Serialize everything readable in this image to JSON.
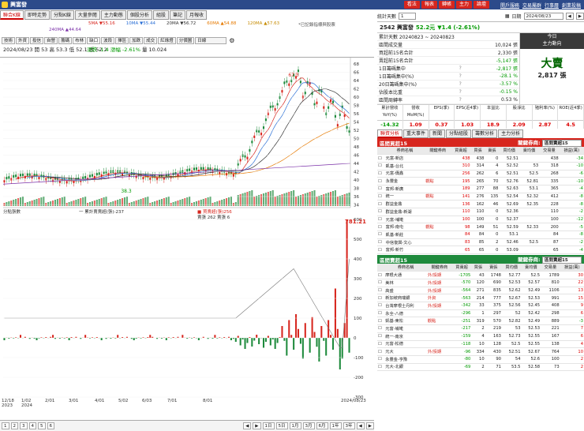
{
  "app": {
    "title": "興富發",
    "buttons": [
      "看法",
      "報表",
      "轉帳",
      "主力",
      "論壇"
    ],
    "links": [
      "開戶服務",
      "交易屬群",
      "行事曆",
      "創業投稿"
    ]
  },
  "tabs": [
    "聯合K線",
    "即時走勢",
    "分點K線",
    "大量參閱",
    "主力動態",
    "個股分析",
    "組股",
    "筆記",
    "月報收"
  ],
  "legend": {
    "sma5": "5MA ▼55.16",
    "sma10": "10MA ▼55.44",
    "sma20": "20MA ▼56.72",
    "sma60": "60MA ▲54.88",
    "sma120": "120MA ▲57.63",
    "sma240": "240MA ▲44.64",
    "note": "*已記錄指標與股票"
  },
  "toolbar": [
    "技術",
    "外資",
    "投信",
    "自營",
    "籌碼",
    "布林",
    "缺口",
    "波段",
    "擇區",
    "加跌",
    "成交",
    "紅綠燈",
    "分價圖",
    "日線"
  ],
  "info": {
    "date": "2024/08/23",
    "open": "開 53",
    "high": "高 53.3",
    "low": "低 52.1",
    "close": "收 52.2",
    "change": "漲跌 -1.4",
    "pct": "漲幅 -2.61%",
    "vol": "量 10.024"
  },
  "annot": {
    "peak": "67.3",
    "low": "38.3"
  },
  "yaxis": [
    "68",
    "66",
    "64",
    "62",
    "60",
    "58",
    "56",
    "54",
    "52",
    "50",
    "48",
    "46",
    "44",
    "42",
    "40",
    "38",
    "36",
    "34"
  ],
  "subpanel": {
    "legend_left": "分點張數",
    "legend_mid": "一 累計賣賣超(張)-237",
    "legend_right": "■ 買賣超(張)256",
    "legend_r2": "賣張 262 賣張 6",
    "value": "781.21"
  },
  "subyaxis": [
    "600",
    "500",
    "400",
    "300",
    "200",
    "100",
    "0",
    "-100",
    "-200",
    "-300",
    "-400"
  ],
  "xaxis": [
    "12/18\n2023",
    "1/02\n2024",
    "2/01",
    "3/01",
    "4/01",
    "5/02",
    "6/03",
    "7/01",
    "8/01",
    "2024/08/23"
  ],
  "bottom": {
    "pages": [
      "1",
      "2",
      "3",
      "4",
      "5",
      "6"
    ],
    "periods": [
      "1日",
      "5日",
      "1月",
      "3月",
      "6月",
      "1年",
      "3年"
    ]
  },
  "right": {
    "ctrl": {
      "label": "統計天數",
      "value": "1",
      "date_label": "日期",
      "date": "2024/08/23"
    },
    "stock": {
      "code": "2542 興富發",
      "price": "52.2元",
      "chg": "▼1.4 (-2.61%)",
      "range": "累計天數 20240823 ~ 20240823"
    },
    "stats": [
      [
        "區間成交量",
        "",
        "10,024 張"
      ],
      [
        "買超前15名合計",
        "",
        "2,330 張"
      ],
      [
        "賣超前15名合計",
        "",
        "-5,147 張"
      ],
      [
        "1日籌碼集中",
        "?",
        "-2,817 張"
      ],
      [
        "1日籌碼集中(%)",
        "?",
        "-28.1 %"
      ],
      [
        "20日籌碼集中(%)",
        "?",
        "-3.57 %"
      ],
      [
        "佔股本比重",
        "?",
        "-0.15 %"
      ],
      [
        "區間周轉率",
        "?",
        "0.53 %"
      ]
    ],
    "big": {
      "hdr1": "今日",
      "hdr2": "主力動向",
      "val": "大賣",
      "sub": "2,817 張"
    },
    "metric_hdr": [
      "累計營收YoY(%)",
      "營收MoM(%)",
      "EPS(季)",
      "EPS(近4季)",
      "本益比",
      "股淨比",
      "殖利率(%)",
      "ROE(近4季)"
    ],
    "metric_val": [
      "-14.32",
      "1.09",
      "0.37",
      "1.03",
      "18.9",
      "2.09",
      "2.87",
      "4.5"
    ],
    "subtabs": [
      "聯資分析",
      "重大事件",
      "新聞",
      "分點組股",
      "籌數分析",
      "主力分析"
    ],
    "buy_title": "區間買超15",
    "sell_title": "區間賣超15",
    "filter": {
      "label": "關鍵券商:",
      "value": "區間賣超15"
    },
    "cols": [
      "",
      "券商名稱",
      "關鍵券商",
      "買賣超",
      "買張",
      "賣張",
      "買均價",
      "賣均價",
      "交易量",
      "損益(萬)"
    ],
    "buys": [
      [
        "",
        "元富-新店",
        "",
        "438",
        "438",
        "0",
        "52.51",
        "",
        "438",
        "-34"
      ],
      [
        "",
        "凱基-台北",
        "",
        "310",
        "314",
        "4",
        "52.52",
        "53",
        "318",
        "-10"
      ],
      [
        "",
        "元富-僑鑫",
        "",
        "256",
        "262",
        "6",
        "52.51",
        "52.5",
        "268",
        "-6"
      ],
      [
        "",
        "永豐金",
        "觀點",
        "195",
        "265",
        "70",
        "52.76",
        "52.81",
        "335",
        "-10"
      ],
      [
        "",
        "富邦-新廣",
        "",
        "189",
        "277",
        "88",
        "52.63",
        "53.1",
        "365",
        "-4"
      ],
      [
        "",
        "統一",
        "觀點",
        "141",
        "276",
        "135",
        "52.54",
        "52.32",
        "412",
        "-8"
      ],
      [
        "",
        "群益金鼎",
        "",
        "136",
        "162",
        "46",
        "52.69",
        "52.35",
        "228",
        "-8"
      ],
      [
        "",
        "群益金鼎-新湖",
        "",
        "110",
        "110",
        "0",
        "52.36",
        "",
        "110",
        "-2"
      ],
      [
        "",
        "元富-埔墘",
        "",
        "100",
        "100",
        "0",
        "52.37",
        "",
        "100",
        "-12"
      ],
      [
        "",
        "富邦-南屯",
        "觀點",
        "98",
        "149",
        "51",
        "52.59",
        "52.33",
        "200",
        "-5"
      ],
      [
        "",
        "凱基-新莊",
        "",
        "84",
        "84",
        "0",
        "53.1",
        "",
        "84",
        "-8"
      ],
      [
        "",
        "中信復興-文心",
        "",
        "83",
        "85",
        "2",
        "52.46",
        "52.5",
        "87",
        "-2"
      ],
      [
        "",
        "富邦-新竹",
        "",
        "65",
        "65",
        "0",
        "53.09",
        "",
        "65",
        "-4"
      ]
    ],
    "sells": [
      [
        "",
        "摩根大通",
        "外/投期",
        "-1705",
        "43",
        "1748",
        "52.77",
        "52.5",
        "1789",
        "30"
      ],
      [
        "",
        "美林",
        "外/投期",
        "-570",
        "120",
        "690",
        "52.53",
        "52.57",
        "810",
        "22"
      ],
      [
        "",
        "高盛",
        "外/投期",
        "-564",
        "271",
        "835",
        "52.62",
        "52.49",
        "1106",
        "13"
      ],
      [
        "",
        "新加坡商瑞銀",
        "外資",
        "-563",
        "214",
        "777",
        "52.67",
        "52.53",
        "991",
        "15"
      ],
      [
        "",
        "台灣摩根士丹利",
        "外/投期",
        "-342",
        "33",
        "375",
        "52.56",
        "52.45",
        "408",
        "9"
      ],
      [
        "",
        "永全-八德",
        "",
        "-296",
        "1",
        "297",
        "52",
        "52.42",
        "298",
        "6"
      ],
      [
        "",
        "凱基-東松",
        "觀點",
        "-251",
        "319",
        "570",
        "52.82",
        "52.49",
        "889",
        "-3"
      ],
      [
        "",
        "元富-埔墘",
        "",
        "-217",
        "2",
        "219",
        "53",
        "52.53",
        "221",
        "7"
      ],
      [
        "",
        "統一-南京",
        "",
        "-159",
        "4",
        "163",
        "52.73",
        "52.55",
        "167",
        "6"
      ],
      [
        "",
        "元富-松德",
        "",
        "-118",
        "10",
        "128",
        "52.5",
        "52.55",
        "138",
        "4"
      ],
      [
        "",
        "元大",
        "外/投期",
        "-96",
        "334",
        "430",
        "52.51",
        "52.67",
        "764",
        "10"
      ],
      [
        "",
        "永豐金-亨豫",
        "",
        "-80",
        "10",
        "90",
        "54",
        "52.6",
        "100",
        "2"
      ],
      [
        "",
        "元大-北銀",
        "",
        "-69",
        "2",
        "71",
        "53.5",
        "52.58",
        "73",
        "2"
      ]
    ]
  },
  "colors": {
    "red": "#d7261e",
    "green": "#1e8a3c",
    "buy_hdr": "#d7261e",
    "sell_hdr": "#1e8a3c"
  }
}
